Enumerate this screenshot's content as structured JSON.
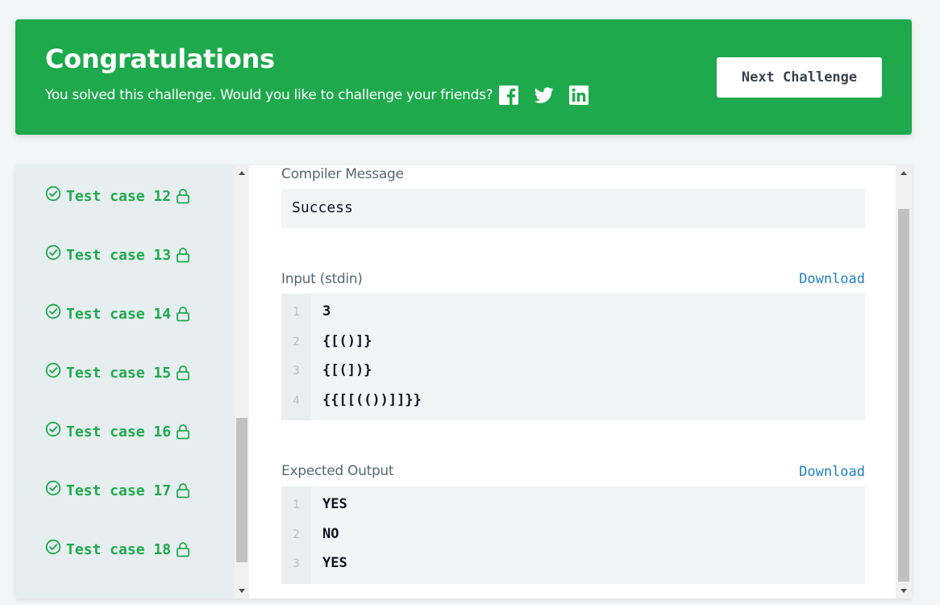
{
  "banner": {
    "title": "Congratulations",
    "subtitle": "You solved this challenge. Would you like to challenge your friends?",
    "social_icons": [
      "facebook-icon",
      "twitter-icon",
      "linkedin-icon"
    ],
    "next_button_label": "Next Challenge",
    "color": "#1ea94d"
  },
  "sidebar": {
    "test_cases": [
      {
        "label": "Test case 12"
      },
      {
        "label": "Test case 13"
      },
      {
        "label": "Test case 14"
      },
      {
        "label": "Test case 15"
      },
      {
        "label": "Test case 16"
      },
      {
        "label": "Test case 17"
      },
      {
        "label": "Test case 18"
      }
    ],
    "accent": "#1ea94d"
  },
  "compiler": {
    "label": "Compiler Message",
    "message": "Success"
  },
  "input": {
    "label": "Input (stdin)",
    "download_label": "Download",
    "lines": [
      {
        "n": "1",
        "text": "3"
      },
      {
        "n": "2",
        "text": "{[()]}"
      },
      {
        "n": "3",
        "text": "{[(])}"
      },
      {
        "n": "4",
        "text": "{{[[(())]]}}"
      }
    ]
  },
  "expected": {
    "label": "Expected Output",
    "download_label": "Download",
    "lines": [
      {
        "n": "1",
        "text": "YES"
      },
      {
        "n": "2",
        "text": "NO"
      },
      {
        "n": "3",
        "text": "YES"
      }
    ]
  }
}
